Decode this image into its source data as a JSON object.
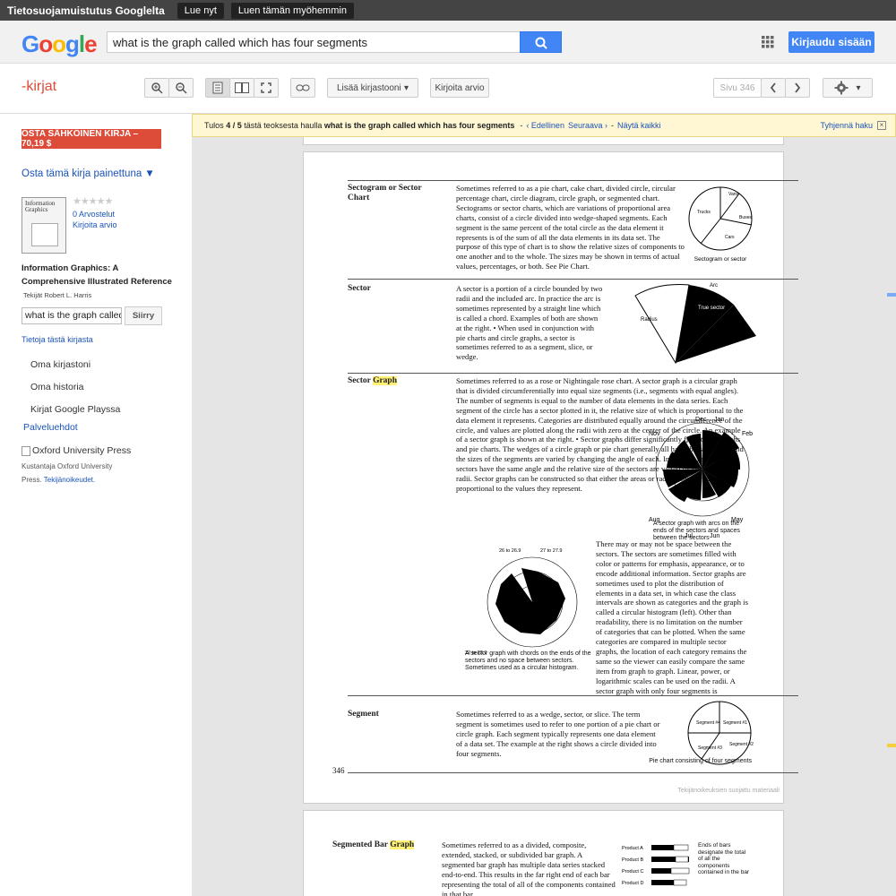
{
  "topbar": {
    "title": "Tietosuojamuistutus Googlelta",
    "read_now": "Lue nyt",
    "read_later": "Luen tämän myöhemmin"
  },
  "header": {
    "search_value": "what is the graph called which has four segments",
    "signin": "Kirjaudu sisään"
  },
  "toolbar": {
    "brand": "-kirjat",
    "add_library": "Lisää kirjastooni",
    "write_review": "Kirjoita arvio",
    "page_label": "Sivu 346"
  },
  "sidebar": {
    "buy": "OSTA SÄHKÖINEN KIRJA – 70,19 $",
    "buy_print": "Osta tämä kirja painettuna ▼",
    "ratings": "0 Arvostelut",
    "write_review": "Kirjoita arvio",
    "book_title": "Information Graphics: A Comprehensive Illustrated Reference",
    "authors": "Tekijät Robert L. Harris",
    "search_value": "what is the graph called",
    "go": "Siirry",
    "about": "Tietoja tästä kirjasta",
    "nav": [
      "Oma kirjastoni",
      "Oma historia",
      "Kirjat Google Playssa"
    ],
    "terms": "Palveluehdot",
    "publisher_img": "Oxford University Press",
    "publisher_text": "Kustantaja Oxford University Press.",
    "rights": "Tekijänoikeudet."
  },
  "notice": {
    "prefix": "Tulos",
    "index": "4",
    "sep": "/",
    "total": "5",
    "mid": "tästä teoksesta haulla",
    "query": "what is the graph called which has four segments",
    "prev": "‹ Edellinen",
    "next": "Seuraava ›",
    "all": "Näytä kaikki",
    "clear": "Tyhjennä haku"
  },
  "page": {
    "sectogram_term": "Sectogram or Sector Chart",
    "sectogram_text": "Sometimes referred to as a pie chart, cake chart, divided circle, circular percentage chart, circle diagram, circle graph, or segmented chart. Sectograms or sector charts, which are variations of proportional area charts, consist of a circle divided into wedge-shaped segments. Each segment is the same percent of the total circle as the data element it represents is of the sum of all the data elements in its data set. The purpose of this type of chart is to show the relative sizes of components to one another and to the whole. The sizes may be shown in terms of actual values, percentages, or both. See Pie Chart.",
    "pie_caption": "Sectogram or sector chart",
    "sector_term": "Sector",
    "sector_text": "A sector is a portion of a circle bounded by two radii and the included arc. In practice the arc is sometimes represented by a straight line which is called a chord. Examples of both are shown at the right. • When used in conjunction with pie charts and circle graphs, a sector is sometimes referred to as a segment, slice, or wedge.",
    "fan_labels": {
      "arc": "Arc",
      "radius": "Radius",
      "true_sector": "True sector",
      "chord": "Sector with arc replaced by a straight line called a chord"
    },
    "sector_graph_term": "Sector Graph",
    "sector_graph_text": "Sometimes referred to as a rose or Nightingale rose chart. A sector graph is a circular graph that is divided circumferentially into equal size segments (i.e., segments with equal angles). The number of segments is equal to the number of data elements in the data series. Each segment of the circle has a sector plotted in it, the relative size of which is proportional to the data element it represents. Categories are distributed equally around the circumference of the circle, and values are plotted along the radii with zero at the center of the circle. An example of a sector graph is shown at the right. • Sector graphs differ significantly from circle graphs and pie charts. The wedges of a circle graph or pie chart generally all have the same radii and the sizes of the segments are varied by changing the angle of each. In a sector graph, all sectors have the same angle and the relative size of the sectors are varied by changing the radii. Sector graphs can be constructed so that either the areas or radii of the sectors are proportional to the values they represent.",
    "rose_caption": "A sector graph with arcs on the ends of the sectors and spaces between the sectors",
    "months": [
      "Jan",
      "Feb",
      "Mar",
      "Apr",
      "May",
      "Jun",
      "Jul",
      "Aug",
      "Sep",
      "Oct",
      "Nov",
      "Dec"
    ],
    "hist_caption": "A sector graph with chords on the ends of the sectors and no space between sectors. Sometimes used as a circular histogram.",
    "hist_text": "There may or may not be space between the sectors. The sectors are sometimes filled with color or patterns for emphasis, appearance, or to encode additional information. Sector graphs are sometimes used to plot the distribution of elements in a data set, in which case the class intervals are shown as categories and the graph is called a circular histogram (left). Other than readability, there is no limitation on the number of categories that can be plotted. When the same categories are compared in multiple sector graphs, the location of each category remains the same so the viewer can easily compare the same item from graph to graph. Linear, power, or logarithmic scales can be used on the radii. A sector graph with only four segments is sometimes called a two-by-two or four-fold chart. See Four-Fold Chart/Graph.",
    "segment_term": "Segment",
    "segment_text": "Sometimes referred to as a wedge, sector, or slice. The term segment is sometimes used to refer to one portion of a pie chart or circle graph. Each segment typically represents one data element of a data set. The example at the right shows a circle divided into four segments.",
    "seg_caption": "Pie chart consisting of four segments",
    "page_number": "346",
    "copyright": "Tekijänoikeuksien suojattu materiaali",
    "next_term": "Segmented Bar Graph",
    "next_text": "Sometimes referred to as a divided, composite, extended, stacked, or subdivided bar graph. A segmented bar graph has multiple data series stacked end-to-end. This results in the far right end of each bar representing the total of all of the components contained in that bar.",
    "next_caption": "Ends of bars designate the total of all the components contained in the bar"
  },
  "chart_data": [
    {
      "type": "pie",
      "title": "",
      "categories": [
        "Vans",
        "Buses",
        "Cars",
        "Trucks"
      ],
      "values": [
        10,
        25,
        35,
        30
      ],
      "labels": [
        "Vans 20 10%",
        "Buses 50 25%",
        "Cars 60 30%",
        "Trucks 70 35%"
      ]
    },
    {
      "type": "pie",
      "title": "",
      "categories": [
        "Segment #1",
        "Segment #2",
        "Segment #3",
        "Segment #4"
      ],
      "values": [
        25,
        25,
        25,
        25
      ]
    },
    {
      "type": "bar",
      "title": "",
      "categories": [
        "Product A",
        "Product B",
        "Product C",
        "Product D",
        "Product E"
      ],
      "series": [
        {
          "values": [
            55,
            60,
            58,
            52,
            50
          ]
        },
        {
          "values": [
            20,
            18,
            25,
            22,
            20
          ]
        }
      ]
    }
  ]
}
